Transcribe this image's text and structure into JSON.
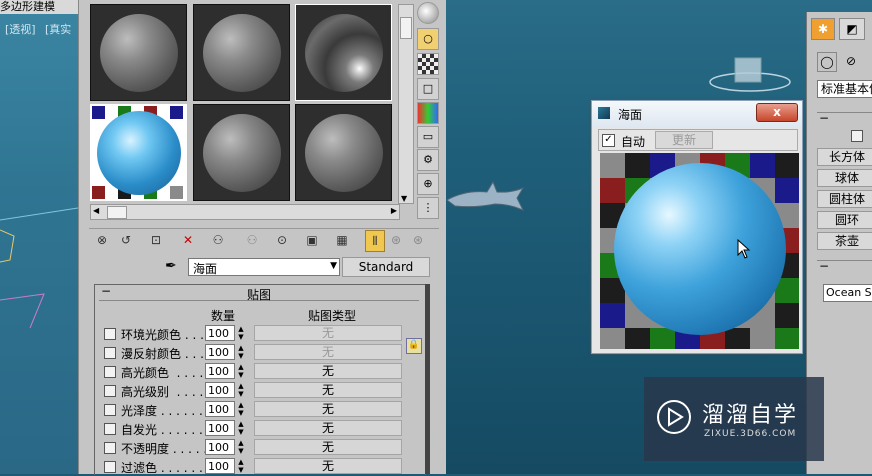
{
  "window": {
    "left_title": "多边形建模",
    "viewport_label_1": "[透视]",
    "viewport_label_2": "[真实"
  },
  "material_editor": {
    "toolbar_icons": [
      "put-to-scene-icon",
      "assign-material-icon",
      "reset-icon",
      "delete-icon",
      "make-unique-icon",
      "put-to-library-icon",
      "material-id-icon",
      "show-map-icon",
      "show-end-icon",
      "go-to-parent-icon",
      "go-forward-icon",
      "go-to-sibling-icon"
    ],
    "side_icons": [
      "sample-type-icon",
      "backlight-icon",
      "background-icon",
      "uv-tiling-icon",
      "video-color-icon",
      "make-preview-icon",
      "options-icon",
      "select-by-material-icon",
      "material-navigator-icon"
    ],
    "material_name": "海面",
    "material_type_button": "Standard",
    "rollout_title": "贴图",
    "col_amount": "数量",
    "col_map_type": "贴图类型",
    "map_rows": [
      {
        "label": "环境光颜色 . . . .",
        "amount": "100",
        "map": "无",
        "disabled": true
      },
      {
        "label": "漫反射颜色 . . . .",
        "amount": "100",
        "map": "无",
        "disabled": true
      },
      {
        "label": "高光颜色  . . . . .",
        "amount": "100",
        "map": "无",
        "disabled": false
      },
      {
        "label": "高光级别  . . . . .",
        "amount": "100",
        "map": "无",
        "disabled": false
      },
      {
        "label": "光泽度 . . . . . .",
        "amount": "100",
        "map": "无",
        "disabled": false
      },
      {
        "label": "自发光 . . . . . .",
        "amount": "100",
        "map": "无",
        "disabled": false
      },
      {
        "label": "不透明度 . . . . .",
        "amount": "100",
        "map": "无",
        "disabled": false
      },
      {
        "label": "过滤色 . . . . . .",
        "amount": "100",
        "map": "无",
        "disabled": false
      }
    ]
  },
  "ocean_dialog": {
    "title": "海面",
    "close_label": "x",
    "auto_label": "自动",
    "auto_checked": true,
    "update_label": "更新"
  },
  "command_panel": {
    "object_type": "标准基本体",
    "buttons": [
      "长方体",
      "球体",
      "圆柱体",
      "圆环",
      "茶壶"
    ],
    "material_field": "Ocean Su"
  },
  "watermark": {
    "brand": "溜溜自学",
    "url": "ZIXUE.3D66.COM"
  },
  "colors": {
    "checker_a": "#8a8a8a",
    "checker_b": "#1d1d1d",
    "checker_red": "#8a1d1d",
    "checker_green": "#1a7a1a",
    "checker_blue": "#1a1a8a"
  }
}
